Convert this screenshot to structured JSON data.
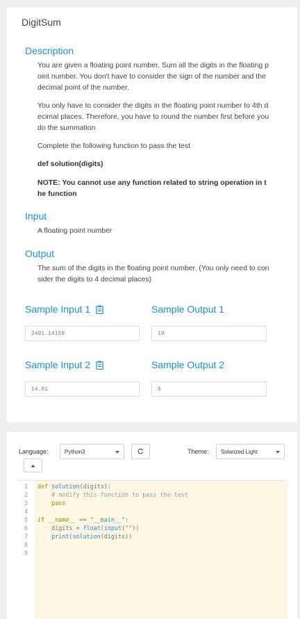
{
  "problem": {
    "title": "DigitSum",
    "description_heading": "Description",
    "description": [
      "You are given a floating point number. Sum all the digits in the floating point number. You don't have to consider the sign of the number and the decimal point of the number.",
      "You only have to consider the digits in the floating point number to 4th decimal places. Therefore, you have to round the number first before you do the summation",
      "Complete the following function to pass the test",
      "def solution(digits)",
      "NOTE: You cannot use any function related to string operation in the function"
    ],
    "input_heading": "Input",
    "input_text": "A floating point number",
    "output_heading": "Output",
    "output_text": "The sum of the digits in the floating point number. (You only need to consider the digits to 4 decimal places)",
    "samples": [
      {
        "input_label": "Sample Input 1",
        "input": "2401.14159",
        "output_label": "Sample Output 1",
        "output": "19"
      },
      {
        "input_label": "Sample Input 2",
        "input": "14.01",
        "output_label": "Sample Output 2",
        "output": "6"
      }
    ]
  },
  "toolbar": {
    "language_label": "Language:",
    "language_value": "Python3",
    "theme_label": "Theme:",
    "theme_value": "Solarized Light",
    "reset_icon": "refresh-icon",
    "collapse_icon": "chevron-up-icon"
  },
  "editor": {
    "line_numbers": [
      "1",
      "2",
      "3",
      "4",
      "5",
      "6",
      "7",
      "8",
      "9"
    ],
    "code_lines": [
      "def solution(digits):",
      "    # modify this function to pass the test",
      "    pass",
      "",
      "if __name__ == \"__main__\":",
      "    digits = float(input(\"\"))",
      "    print(solution(digits))",
      "",
      ""
    ],
    "theme_colors": {
      "background": "#fdf6e3",
      "keyword": "#859900",
      "function": "#268bd2",
      "comment": "#93a1a1",
      "string": "#2aa198"
    }
  },
  "colors": {
    "accent": "#1a8fd8",
    "page_background": "#eeeeee"
  }
}
